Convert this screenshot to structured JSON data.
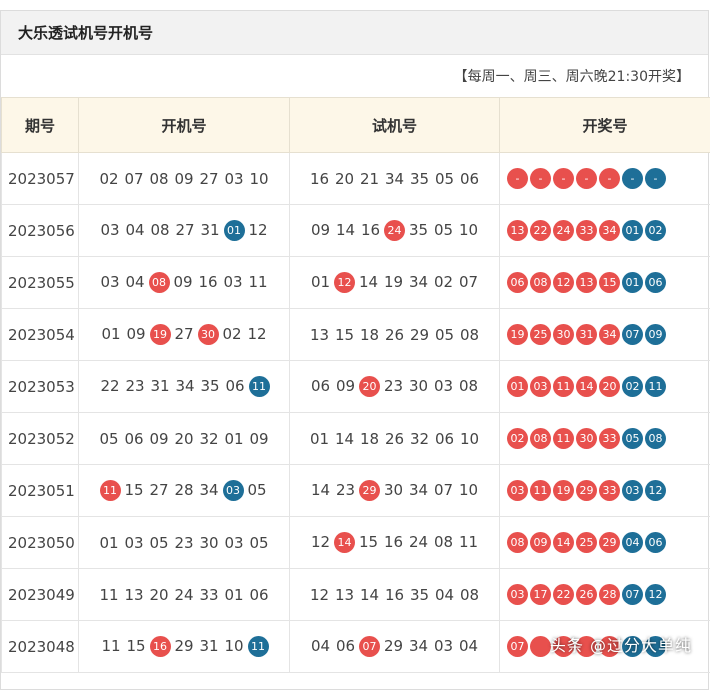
{
  "title": "大乐透试机号开机号",
  "schedule": "【每周一、周三、周六晚21:30开奖】",
  "headers": [
    "期号",
    "开机号",
    "试机号",
    "开奖号"
  ],
  "colors": {
    "red": "#e8504d",
    "blue": "#1e6f98",
    "header_bg": "#fdf7e8"
  },
  "rows": [
    {
      "issue": "2023057",
      "kaiji": [
        {
          "n": "02"
        },
        {
          "n": "07"
        },
        {
          "n": "08"
        },
        {
          "n": "09"
        },
        {
          "n": "27"
        },
        {
          "n": "03"
        },
        {
          "n": "10"
        }
      ],
      "shiji": [
        {
          "n": "16"
        },
        {
          "n": "20"
        },
        {
          "n": "21"
        },
        {
          "n": "34"
        },
        {
          "n": "35"
        },
        {
          "n": "05"
        },
        {
          "n": "06"
        }
      ],
      "prize": [
        {
          "n": "-",
          "c": "red"
        },
        {
          "n": "-",
          "c": "red"
        },
        {
          "n": "-",
          "c": "red"
        },
        {
          "n": "-",
          "c": "red"
        },
        {
          "n": "-",
          "c": "red"
        },
        {
          "n": "-",
          "c": "blue"
        },
        {
          "n": "-",
          "c": "blue"
        }
      ]
    },
    {
      "issue": "2023056",
      "kaiji": [
        {
          "n": "03"
        },
        {
          "n": "04"
        },
        {
          "n": "08"
        },
        {
          "n": "27"
        },
        {
          "n": "31"
        },
        {
          "n": "01",
          "c": "blue"
        },
        {
          "n": "12"
        }
      ],
      "shiji": [
        {
          "n": "09"
        },
        {
          "n": "14"
        },
        {
          "n": "16"
        },
        {
          "n": "24",
          "c": "red"
        },
        {
          "n": "35"
        },
        {
          "n": "05"
        },
        {
          "n": "10"
        }
      ],
      "prize": [
        {
          "n": "13",
          "c": "red"
        },
        {
          "n": "22",
          "c": "red"
        },
        {
          "n": "24",
          "c": "red"
        },
        {
          "n": "33",
          "c": "red"
        },
        {
          "n": "34",
          "c": "red"
        },
        {
          "n": "01",
          "c": "blue"
        },
        {
          "n": "02",
          "c": "blue"
        }
      ]
    },
    {
      "issue": "2023055",
      "kaiji": [
        {
          "n": "03"
        },
        {
          "n": "04"
        },
        {
          "n": "08",
          "c": "red"
        },
        {
          "n": "09"
        },
        {
          "n": "16"
        },
        {
          "n": "03"
        },
        {
          "n": "11"
        }
      ],
      "shiji": [
        {
          "n": "01"
        },
        {
          "n": "12",
          "c": "red"
        },
        {
          "n": "14"
        },
        {
          "n": "19"
        },
        {
          "n": "34"
        },
        {
          "n": "02"
        },
        {
          "n": "07"
        }
      ],
      "prize": [
        {
          "n": "06",
          "c": "red"
        },
        {
          "n": "08",
          "c": "red"
        },
        {
          "n": "12",
          "c": "red"
        },
        {
          "n": "13",
          "c": "red"
        },
        {
          "n": "15",
          "c": "red"
        },
        {
          "n": "01",
          "c": "blue"
        },
        {
          "n": "06",
          "c": "blue"
        }
      ]
    },
    {
      "issue": "2023054",
      "kaiji": [
        {
          "n": "01"
        },
        {
          "n": "09"
        },
        {
          "n": "19",
          "c": "red"
        },
        {
          "n": "27"
        },
        {
          "n": "30",
          "c": "red"
        },
        {
          "n": "02"
        },
        {
          "n": "12"
        }
      ],
      "shiji": [
        {
          "n": "13"
        },
        {
          "n": "15"
        },
        {
          "n": "18"
        },
        {
          "n": "26"
        },
        {
          "n": "29"
        },
        {
          "n": "05"
        },
        {
          "n": "08"
        }
      ],
      "prize": [
        {
          "n": "19",
          "c": "red"
        },
        {
          "n": "25",
          "c": "red"
        },
        {
          "n": "30",
          "c": "red"
        },
        {
          "n": "31",
          "c": "red"
        },
        {
          "n": "34",
          "c": "red"
        },
        {
          "n": "07",
          "c": "blue"
        },
        {
          "n": "09",
          "c": "blue"
        }
      ]
    },
    {
      "issue": "2023053",
      "kaiji": [
        {
          "n": "22"
        },
        {
          "n": "23"
        },
        {
          "n": "31"
        },
        {
          "n": "34"
        },
        {
          "n": "35"
        },
        {
          "n": "06"
        },
        {
          "n": "11",
          "c": "blue"
        }
      ],
      "shiji": [
        {
          "n": "06"
        },
        {
          "n": "09"
        },
        {
          "n": "20",
          "c": "red"
        },
        {
          "n": "23"
        },
        {
          "n": "30"
        },
        {
          "n": "03"
        },
        {
          "n": "08"
        }
      ],
      "prize": [
        {
          "n": "01",
          "c": "red"
        },
        {
          "n": "03",
          "c": "red"
        },
        {
          "n": "11",
          "c": "red"
        },
        {
          "n": "14",
          "c": "red"
        },
        {
          "n": "20",
          "c": "red"
        },
        {
          "n": "02",
          "c": "blue"
        },
        {
          "n": "11",
          "c": "blue"
        }
      ]
    },
    {
      "issue": "2023052",
      "kaiji": [
        {
          "n": "05"
        },
        {
          "n": "06"
        },
        {
          "n": "09"
        },
        {
          "n": "20"
        },
        {
          "n": "32"
        },
        {
          "n": "01"
        },
        {
          "n": "09"
        }
      ],
      "shiji": [
        {
          "n": "01"
        },
        {
          "n": "14"
        },
        {
          "n": "18"
        },
        {
          "n": "26"
        },
        {
          "n": "32"
        },
        {
          "n": "06"
        },
        {
          "n": "10"
        }
      ],
      "prize": [
        {
          "n": "02",
          "c": "red"
        },
        {
          "n": "08",
          "c": "red"
        },
        {
          "n": "11",
          "c": "red"
        },
        {
          "n": "30",
          "c": "red"
        },
        {
          "n": "33",
          "c": "red"
        },
        {
          "n": "05",
          "c": "blue"
        },
        {
          "n": "08",
          "c": "blue"
        }
      ]
    },
    {
      "issue": "2023051",
      "kaiji": [
        {
          "n": "11",
          "c": "red"
        },
        {
          "n": "15"
        },
        {
          "n": "27"
        },
        {
          "n": "28"
        },
        {
          "n": "34"
        },
        {
          "n": "03",
          "c": "blue"
        },
        {
          "n": "05"
        }
      ],
      "shiji": [
        {
          "n": "14"
        },
        {
          "n": "23"
        },
        {
          "n": "29",
          "c": "red"
        },
        {
          "n": "30"
        },
        {
          "n": "34"
        },
        {
          "n": "07"
        },
        {
          "n": "10"
        }
      ],
      "prize": [
        {
          "n": "03",
          "c": "red"
        },
        {
          "n": "11",
          "c": "red"
        },
        {
          "n": "19",
          "c": "red"
        },
        {
          "n": "29",
          "c": "red"
        },
        {
          "n": "33",
          "c": "red"
        },
        {
          "n": "03",
          "c": "blue"
        },
        {
          "n": "12",
          "c": "blue"
        }
      ]
    },
    {
      "issue": "2023050",
      "kaiji": [
        {
          "n": "01"
        },
        {
          "n": "03"
        },
        {
          "n": "05"
        },
        {
          "n": "23"
        },
        {
          "n": "30"
        },
        {
          "n": "03"
        },
        {
          "n": "05"
        }
      ],
      "shiji": [
        {
          "n": "12"
        },
        {
          "n": "14",
          "c": "red"
        },
        {
          "n": "15"
        },
        {
          "n": "16"
        },
        {
          "n": "24"
        },
        {
          "n": "08"
        },
        {
          "n": "11"
        }
      ],
      "prize": [
        {
          "n": "08",
          "c": "red"
        },
        {
          "n": "09",
          "c": "red"
        },
        {
          "n": "14",
          "c": "red"
        },
        {
          "n": "25",
          "c": "red"
        },
        {
          "n": "29",
          "c": "red"
        },
        {
          "n": "04",
          "c": "blue"
        },
        {
          "n": "06",
          "c": "blue"
        }
      ]
    },
    {
      "issue": "2023049",
      "kaiji": [
        {
          "n": "11"
        },
        {
          "n": "13"
        },
        {
          "n": "20"
        },
        {
          "n": "24"
        },
        {
          "n": "33"
        },
        {
          "n": "01"
        },
        {
          "n": "06"
        }
      ],
      "shiji": [
        {
          "n": "12"
        },
        {
          "n": "13"
        },
        {
          "n": "14"
        },
        {
          "n": "16"
        },
        {
          "n": "35"
        },
        {
          "n": "04"
        },
        {
          "n": "08"
        }
      ],
      "prize": [
        {
          "n": "03",
          "c": "red"
        },
        {
          "n": "17",
          "c": "red"
        },
        {
          "n": "22",
          "c": "red"
        },
        {
          "n": "26",
          "c": "red"
        },
        {
          "n": "28",
          "c": "red"
        },
        {
          "n": "07",
          "c": "blue"
        },
        {
          "n": "12",
          "c": "blue"
        }
      ]
    },
    {
      "issue": "2023048",
      "kaiji": [
        {
          "n": "11"
        },
        {
          "n": "15"
        },
        {
          "n": "16",
          "c": "red"
        },
        {
          "n": "29"
        },
        {
          "n": "31"
        },
        {
          "n": "10"
        },
        {
          "n": "11",
          "c": "blue"
        }
      ],
      "shiji": [
        {
          "n": "04"
        },
        {
          "n": "06"
        },
        {
          "n": "07",
          "c": "red"
        },
        {
          "n": "29"
        },
        {
          "n": "34"
        },
        {
          "n": "03"
        },
        {
          "n": "04"
        }
      ],
      "prize": [
        {
          "n": "07",
          "c": "red"
        },
        {
          "n": "",
          "c": "red"
        },
        {
          "n": "",
          "c": "red"
        },
        {
          "n": "",
          "c": "red"
        },
        {
          "n": "",
          "c": "red"
        },
        {
          "n": "",
          "c": "blue"
        },
        {
          "n": "",
          "c": "blue"
        }
      ]
    }
  ],
  "watermark": "头条 @过分大单纯"
}
